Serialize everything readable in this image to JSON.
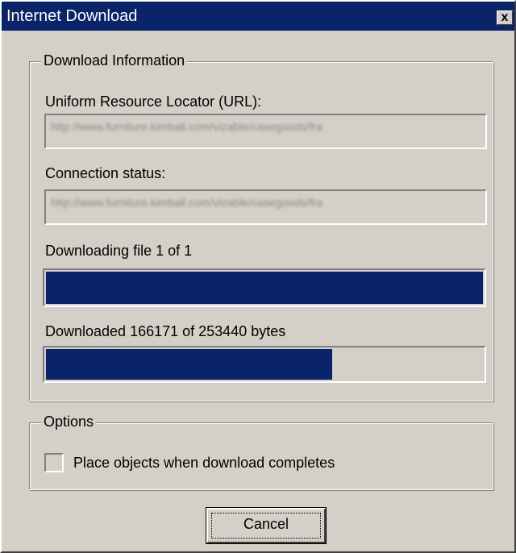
{
  "window": {
    "title": "Internet Download",
    "close_label": "x"
  },
  "download_info": {
    "legend": "Download Information",
    "url_label": "Uniform Resource Locator (URL):",
    "url_value": "http://www.furniture.kimball.com/vizable/casegoods/fra",
    "status_label": "Connection status:",
    "status_value": "http://www.furniture.kimball.com/vizable/casegoods/fra",
    "file_progress_label": "Downloading file 1 of 1",
    "file_progress": {
      "current": 1,
      "total": 1
    },
    "bytes_progress_label": "Downloaded 166171 of 253440 bytes",
    "bytes_progress": {
      "downloaded": 166171,
      "total": 253440
    }
  },
  "options": {
    "legend": "Options",
    "place_objects_label": "Place objects when download completes",
    "place_objects_checked": false
  },
  "buttons": {
    "cancel_label": "Cancel"
  },
  "colors": {
    "title_bar": "#0a246a",
    "progress_fill": "#0a246a",
    "face": "#d4d0c8"
  }
}
